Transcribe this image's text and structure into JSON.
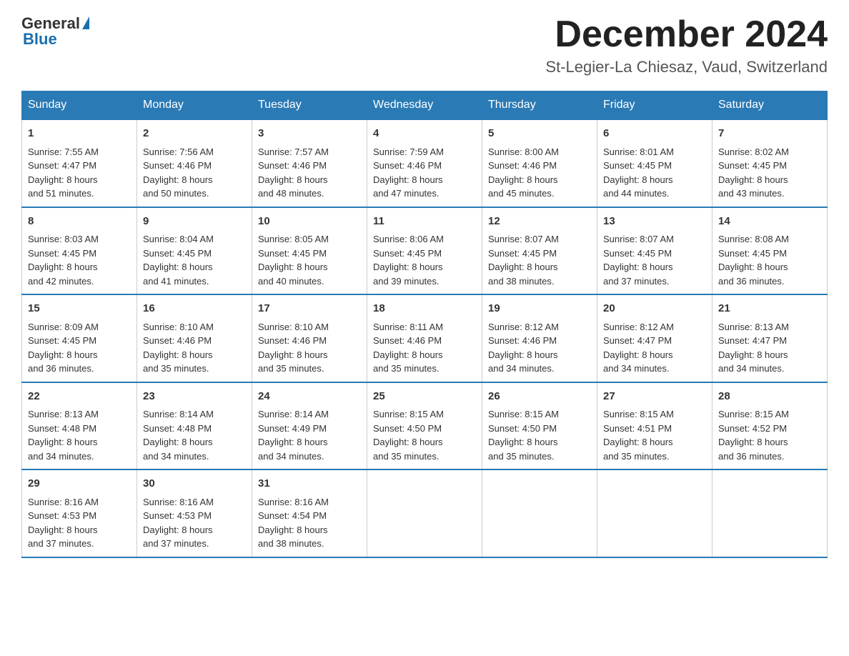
{
  "logo": {
    "general": "General",
    "blue": "Blue"
  },
  "title": {
    "month": "December 2024",
    "location": "St-Legier-La Chiesaz, Vaud, Switzerland"
  },
  "weekdays": [
    "Sunday",
    "Monday",
    "Tuesday",
    "Wednesday",
    "Thursday",
    "Friday",
    "Saturday"
  ],
  "weeks": [
    [
      {
        "day": "1",
        "sunrise": "7:55 AM",
        "sunset": "4:47 PM",
        "daylight": "8 hours and 51 minutes."
      },
      {
        "day": "2",
        "sunrise": "7:56 AM",
        "sunset": "4:46 PM",
        "daylight": "8 hours and 50 minutes."
      },
      {
        "day": "3",
        "sunrise": "7:57 AM",
        "sunset": "4:46 PM",
        "daylight": "8 hours and 48 minutes."
      },
      {
        "day": "4",
        "sunrise": "7:59 AM",
        "sunset": "4:46 PM",
        "daylight": "8 hours and 47 minutes."
      },
      {
        "day": "5",
        "sunrise": "8:00 AM",
        "sunset": "4:46 PM",
        "daylight": "8 hours and 45 minutes."
      },
      {
        "day": "6",
        "sunrise": "8:01 AM",
        "sunset": "4:45 PM",
        "daylight": "8 hours and 44 minutes."
      },
      {
        "day": "7",
        "sunrise": "8:02 AM",
        "sunset": "4:45 PM",
        "daylight": "8 hours and 43 minutes."
      }
    ],
    [
      {
        "day": "8",
        "sunrise": "8:03 AM",
        "sunset": "4:45 PM",
        "daylight": "8 hours and 42 minutes."
      },
      {
        "day": "9",
        "sunrise": "8:04 AM",
        "sunset": "4:45 PM",
        "daylight": "8 hours and 41 minutes."
      },
      {
        "day": "10",
        "sunrise": "8:05 AM",
        "sunset": "4:45 PM",
        "daylight": "8 hours and 40 minutes."
      },
      {
        "day": "11",
        "sunrise": "8:06 AM",
        "sunset": "4:45 PM",
        "daylight": "8 hours and 39 minutes."
      },
      {
        "day": "12",
        "sunrise": "8:07 AM",
        "sunset": "4:45 PM",
        "daylight": "8 hours and 38 minutes."
      },
      {
        "day": "13",
        "sunrise": "8:07 AM",
        "sunset": "4:45 PM",
        "daylight": "8 hours and 37 minutes."
      },
      {
        "day": "14",
        "sunrise": "8:08 AM",
        "sunset": "4:45 PM",
        "daylight": "8 hours and 36 minutes."
      }
    ],
    [
      {
        "day": "15",
        "sunrise": "8:09 AM",
        "sunset": "4:45 PM",
        "daylight": "8 hours and 36 minutes."
      },
      {
        "day": "16",
        "sunrise": "8:10 AM",
        "sunset": "4:46 PM",
        "daylight": "8 hours and 35 minutes."
      },
      {
        "day": "17",
        "sunrise": "8:10 AM",
        "sunset": "4:46 PM",
        "daylight": "8 hours and 35 minutes."
      },
      {
        "day": "18",
        "sunrise": "8:11 AM",
        "sunset": "4:46 PM",
        "daylight": "8 hours and 35 minutes."
      },
      {
        "day": "19",
        "sunrise": "8:12 AM",
        "sunset": "4:46 PM",
        "daylight": "8 hours and 34 minutes."
      },
      {
        "day": "20",
        "sunrise": "8:12 AM",
        "sunset": "4:47 PM",
        "daylight": "8 hours and 34 minutes."
      },
      {
        "day": "21",
        "sunrise": "8:13 AM",
        "sunset": "4:47 PM",
        "daylight": "8 hours and 34 minutes."
      }
    ],
    [
      {
        "day": "22",
        "sunrise": "8:13 AM",
        "sunset": "4:48 PM",
        "daylight": "8 hours and 34 minutes."
      },
      {
        "day": "23",
        "sunrise": "8:14 AM",
        "sunset": "4:48 PM",
        "daylight": "8 hours and 34 minutes."
      },
      {
        "day": "24",
        "sunrise": "8:14 AM",
        "sunset": "4:49 PM",
        "daylight": "8 hours and 34 minutes."
      },
      {
        "day": "25",
        "sunrise": "8:15 AM",
        "sunset": "4:50 PM",
        "daylight": "8 hours and 35 minutes."
      },
      {
        "day": "26",
        "sunrise": "8:15 AM",
        "sunset": "4:50 PM",
        "daylight": "8 hours and 35 minutes."
      },
      {
        "day": "27",
        "sunrise": "8:15 AM",
        "sunset": "4:51 PM",
        "daylight": "8 hours and 35 minutes."
      },
      {
        "day": "28",
        "sunrise": "8:15 AM",
        "sunset": "4:52 PM",
        "daylight": "8 hours and 36 minutes."
      }
    ],
    [
      {
        "day": "29",
        "sunrise": "8:16 AM",
        "sunset": "4:53 PM",
        "daylight": "8 hours and 37 minutes."
      },
      {
        "day": "30",
        "sunrise": "8:16 AM",
        "sunset": "4:53 PM",
        "daylight": "8 hours and 37 minutes."
      },
      {
        "day": "31",
        "sunrise": "8:16 AM",
        "sunset": "4:54 PM",
        "daylight": "8 hours and 38 minutes."
      },
      null,
      null,
      null,
      null
    ]
  ],
  "labels": {
    "sunrise": "Sunrise:",
    "sunset": "Sunset:",
    "daylight": "Daylight:"
  }
}
